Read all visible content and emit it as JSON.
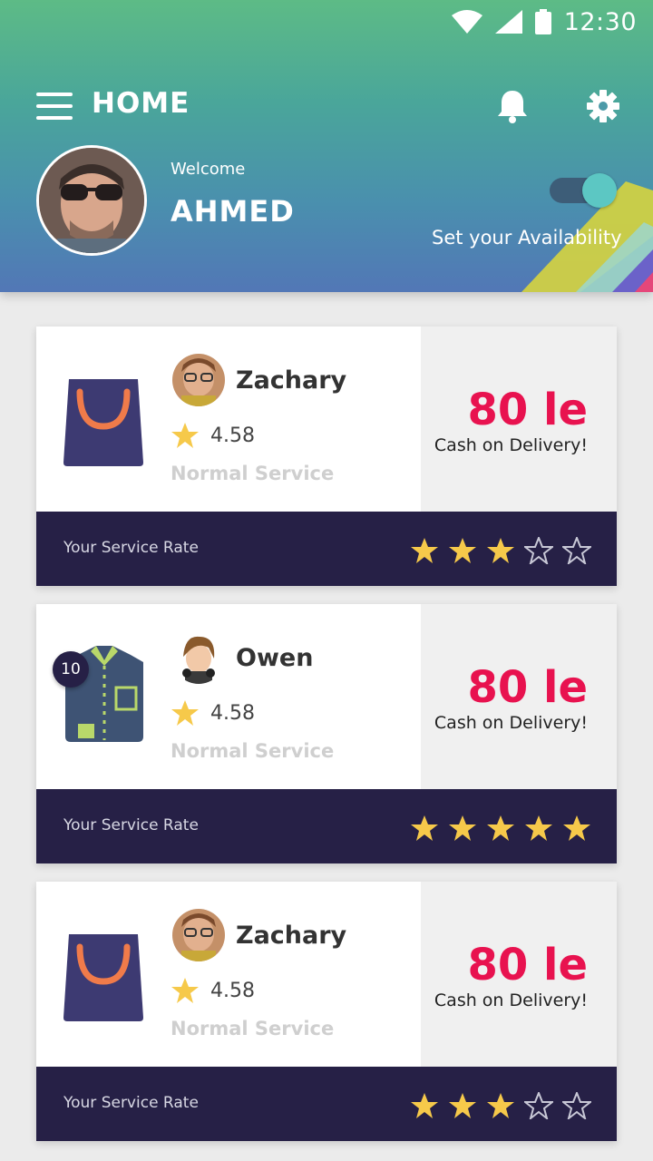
{
  "status_bar": {
    "time": "12:30"
  },
  "header": {
    "title": "HOME",
    "welcome": "Welcome",
    "user_name": "AHMED",
    "availability_label": "Set your Availability",
    "availability_on": true
  },
  "rate_label": "Your Service Rate",
  "colors": {
    "price": "#e8124f",
    "rate_bar": "#262046",
    "star": "#f6c94a",
    "header_top": "#5dbb86",
    "header_bottom": "#5277b6"
  },
  "orders": [
    {
      "product_icon": "shopping-bag-icon",
      "customer": "Zachary",
      "rating": "4.58",
      "service": "Normal Service",
      "price": "80 le",
      "payment": "Cash on Delivery!",
      "stars": 3,
      "badge": ""
    },
    {
      "product_icon": "shirt-icon",
      "customer": "Owen",
      "rating": "4.58",
      "service": "Normal Service",
      "price": "80 le",
      "payment": "Cash on Delivery!",
      "stars": 5,
      "badge": "10"
    },
    {
      "product_icon": "shopping-bag-icon",
      "customer": "Zachary",
      "rating": "4.58",
      "service": "Normal Service",
      "price": "80 le",
      "payment": "Cash on Delivery!",
      "stars": 3,
      "badge": ""
    }
  ]
}
